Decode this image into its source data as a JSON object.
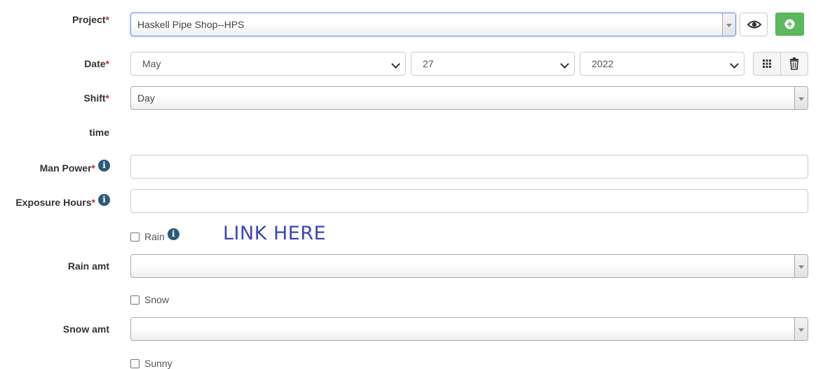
{
  "project": {
    "label": "Project",
    "required_mark": "*",
    "value": "Haskell Pipe Shop--HPS",
    "view_icon": "eye-icon",
    "add_icon": "plus-circle-icon"
  },
  "date": {
    "label": "Date",
    "required_mark": "*",
    "month": "May",
    "day": "27",
    "year": "2022",
    "calendar_icon": "grid-icon",
    "clear_icon": "trash-icon"
  },
  "shift": {
    "label": "Shift",
    "required_mark": "*",
    "value": "Day"
  },
  "time": {
    "label": "time"
  },
  "man_power": {
    "label": "Man Power",
    "required_mark": "*",
    "info_icon": "info-icon",
    "value": ""
  },
  "exposure_hours": {
    "label": "Exposure Hours",
    "required_mark": "*",
    "info_icon": "info-icon",
    "value": ""
  },
  "rain": {
    "label": "Rain",
    "checked": false,
    "info_icon": "info-icon"
  },
  "annotation": {
    "text": "LINK HERE",
    "color": "#3b46b6"
  },
  "rain_amt": {
    "label": "Rain amt",
    "value": ""
  },
  "snow": {
    "label": "Snow",
    "checked": false
  },
  "snow_amt": {
    "label": "Snow amt",
    "value": ""
  },
  "sunny": {
    "label": "Sunny",
    "checked": false
  },
  "colors": {
    "required": "#c9302c",
    "add_button": "#5cb85c",
    "info_icon": "#2b5a7a",
    "focus_border": "#5897fb"
  }
}
